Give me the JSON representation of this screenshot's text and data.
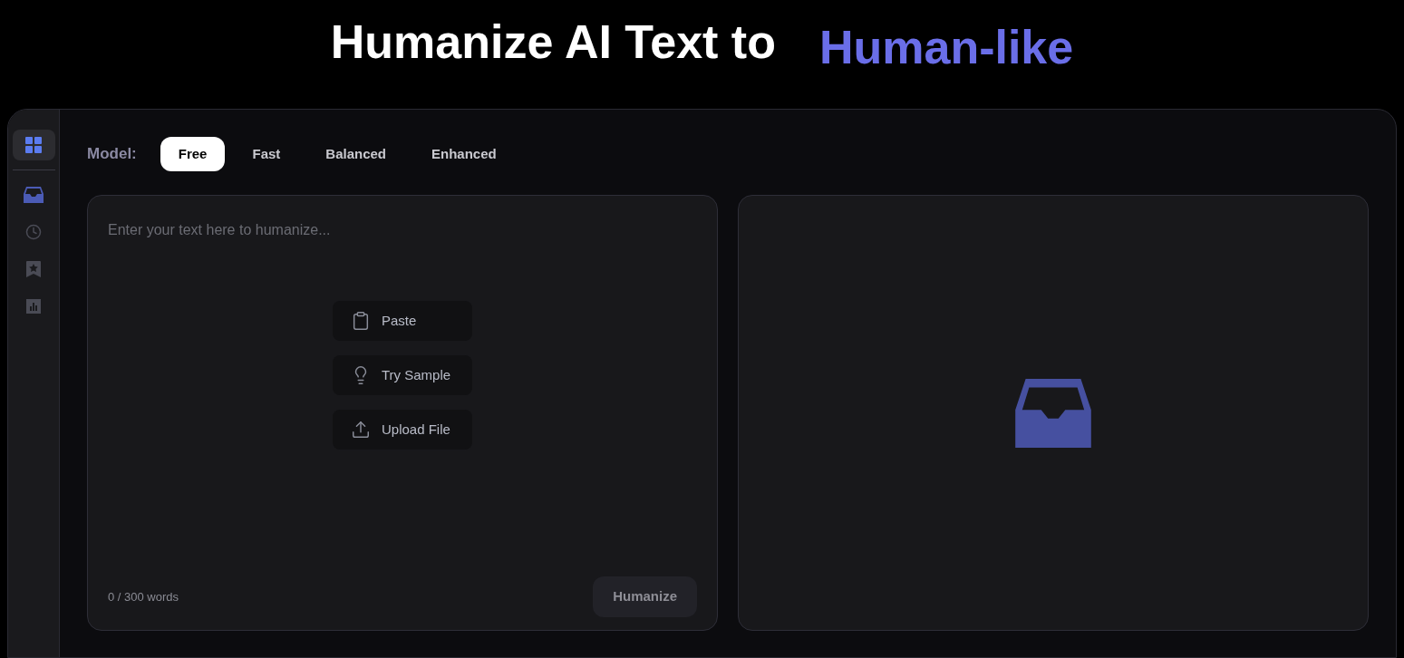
{
  "headline": {
    "text": "Humanize AI Text to",
    "highlight": "Human-like"
  },
  "sidebar": {
    "items": [
      {
        "kind": "grid",
        "selected": true,
        "highlighted": false
      },
      {
        "kind": "inbox",
        "selected": false,
        "highlighted": true
      },
      {
        "kind": "clock",
        "selected": false,
        "highlighted": false
      },
      {
        "kind": "bookmark",
        "selected": false,
        "highlighted": false
      },
      {
        "kind": "chart",
        "selected": false,
        "highlighted": false
      }
    ]
  },
  "model": {
    "label": "Model:",
    "options": [
      {
        "label": "Free",
        "selected": true
      },
      {
        "label": "Fast",
        "selected": false
      },
      {
        "label": "Balanced",
        "selected": false
      },
      {
        "label": "Enhanced",
        "selected": false
      }
    ]
  },
  "input": {
    "placeholder": "Enter your text here to humanize...",
    "actions": [
      {
        "kind": "paste",
        "label": "Paste"
      },
      {
        "kind": "sample",
        "label": "Try Sample"
      },
      {
        "kind": "upload",
        "label": "Upload File"
      }
    ],
    "word_count": "0 / 300 words",
    "submit": {
      "label": "Humanize",
      "disabled": true
    }
  }
}
